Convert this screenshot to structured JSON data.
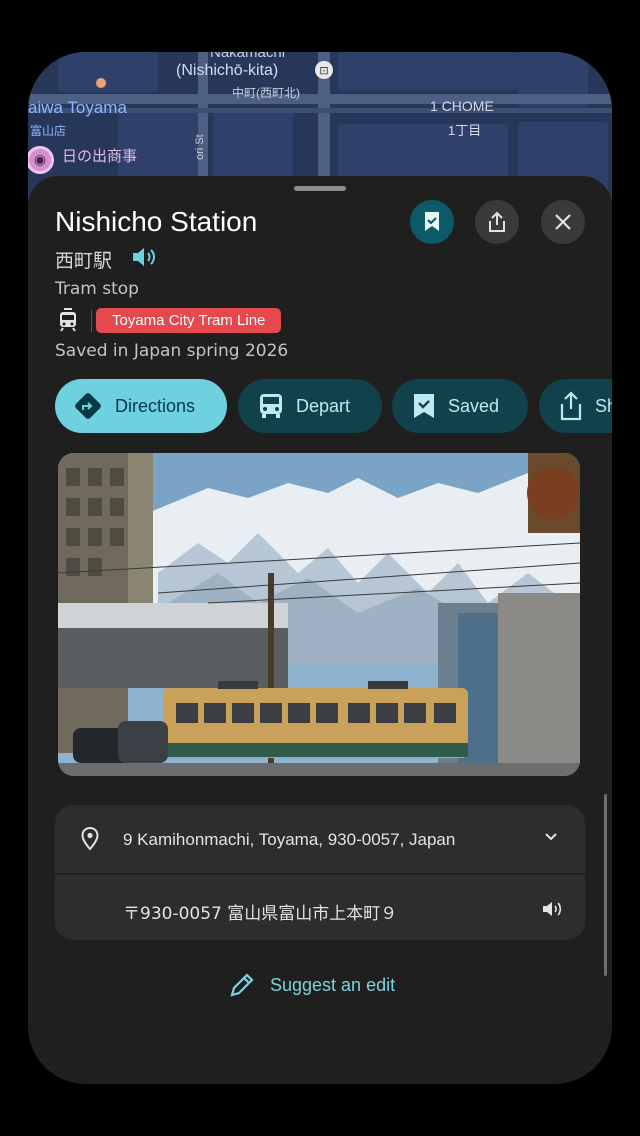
{
  "map": {
    "area_top": "Nakamachi",
    "area_romaji": "(Nishichō-kita)",
    "area_kanji": "中町(西町北)",
    "left_name": "aiwa Toyama",
    "left_sub": "富山店",
    "poi_name": "日の出商事",
    "street": "ori St",
    "chome_en": "1 CHOME",
    "chome_jp": "1丁目"
  },
  "place": {
    "title": "Nishicho Station",
    "native_name": "西町駅",
    "type": "Tram stop",
    "line_name": "Toyama City Tram Line",
    "saved_in": "Saved in Japan spring 2026"
  },
  "actions": {
    "directions": "Directions",
    "depart": "Depart",
    "saved": "Saved",
    "share": "Share"
  },
  "address": {
    "line": "9 Kamihonmachi, Toyama, 930-0057, Japan",
    "local": "〒930-0057 富山県富山市上本町９"
  },
  "suggest_edit": "Suggest an edit",
  "colors": {
    "accent": "#6fd0e0",
    "secondary_chip": "#11414a",
    "line_badge": "#e5484d",
    "sheet_bg": "#1f1f1f",
    "card_bg": "#2b2d2e"
  },
  "icons": {
    "save": "bookmark-check-icon",
    "share": "share-icon",
    "close": "close-icon",
    "speaker": "speaker-icon",
    "tram": "tram-icon",
    "directions": "directions-icon",
    "depart": "bus-icon",
    "location": "location-pin-icon",
    "expand": "chevron-down-icon",
    "edit": "pencil-icon"
  }
}
